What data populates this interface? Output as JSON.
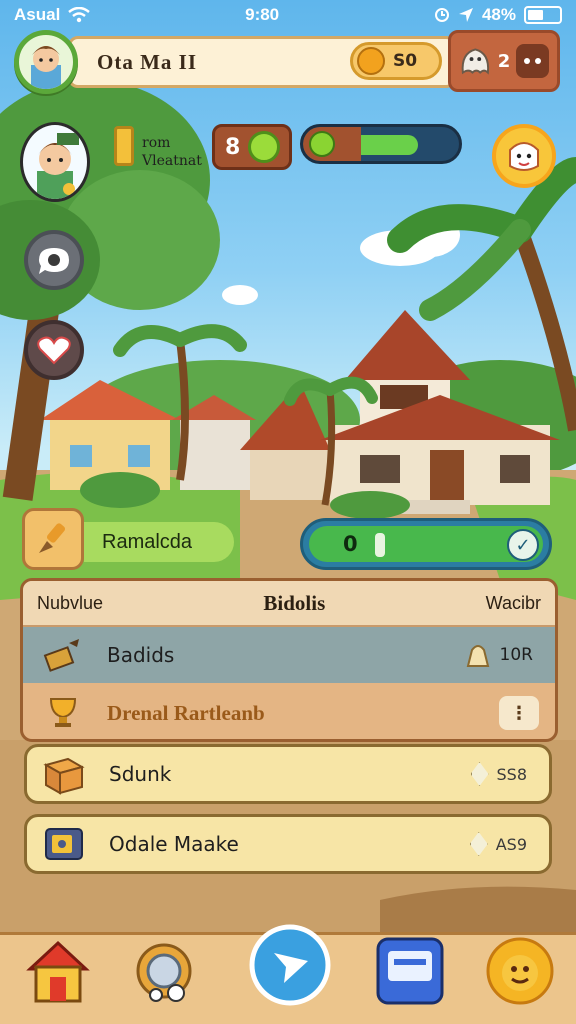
{
  "status_bar": {
    "carrier": "Asual",
    "time": "9:80",
    "battery": "48%"
  },
  "top_hud": {
    "player_name": "Ota Ma II",
    "coins": "S0",
    "ghost_count": "2"
  },
  "profile": {
    "rank_line1": "rom",
    "rank_line2": "Vleatnat",
    "level": "8",
    "xp_fill_pct": 58
  },
  "location": {
    "name": "Ramalcda",
    "progress_value": "0"
  },
  "build_panel": {
    "header_left": "Nubvlue",
    "header_title": "Bidolis",
    "header_right": "Wacibr",
    "selected_item": {
      "label": "Badids",
      "price": "10R"
    },
    "highlight_item": {
      "label": "Drenal Rartleanb",
      "more": "⋮"
    }
  },
  "cards": [
    {
      "label": "Sdunk",
      "price": "SS8"
    },
    {
      "label": "Odale Maake",
      "price": "AS9"
    }
  ],
  "nav": [
    {
      "name": "home"
    },
    {
      "name": "settings"
    },
    {
      "name": "play"
    },
    {
      "name": "shop"
    },
    {
      "name": "profile"
    }
  ],
  "colors": {
    "accent_green": "#48b84c",
    "wood": "#a2522f",
    "panel": "#e4b584",
    "card": "#f7e5a6"
  }
}
